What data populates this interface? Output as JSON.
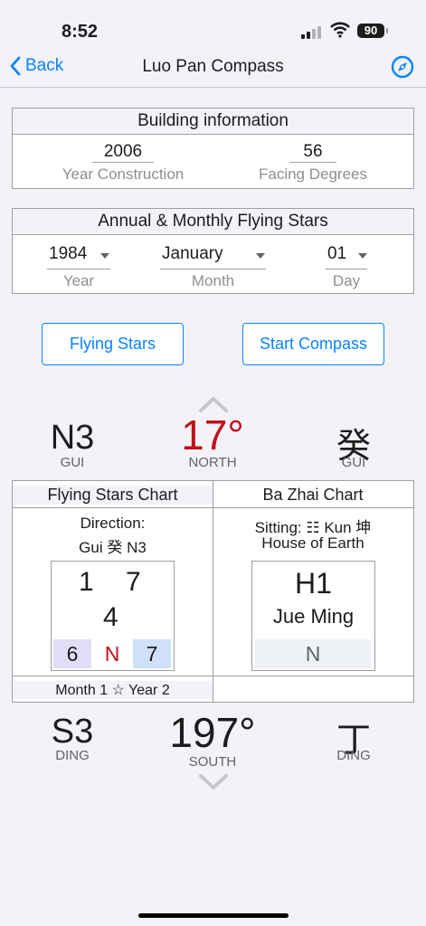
{
  "status": {
    "time": "8:52",
    "battery": "90"
  },
  "nav": {
    "back_label": "Back",
    "title": "Luo Pan Compass"
  },
  "building": {
    "title": "Building information",
    "year_value": "2006",
    "year_label": "Year Construction",
    "facing_value": "56",
    "facing_label": "Facing Degrees"
  },
  "stars": {
    "title": "Annual & Monthly Flying Stars",
    "year_value": "1984",
    "year_label": "Year",
    "month_value": "January",
    "month_label": "Month",
    "day_value": "01",
    "day_label": "Day"
  },
  "buttons": {
    "flying_stars": "Flying Stars",
    "start_compass": "Start Compass"
  },
  "north": {
    "left_code": "N3",
    "left_sub": "GUI",
    "degree": "17°",
    "degree_sub": "NORTH",
    "right_char": "癸",
    "right_sub": "GUI"
  },
  "flying_chart": {
    "header": "Flying Stars Chart",
    "direction_label": "Direction:",
    "direction_value": "Gui 癸 N3",
    "top_left": "1",
    "top_right": "7",
    "center": "4",
    "bottom_left": "6",
    "bottom_mid": "N",
    "bottom_right": "7",
    "footer": "Month 1 ☆ Year 2"
  },
  "bazhai": {
    "header": "Ba Zhai Chart",
    "sitting": "Sitting: ☷ Kun 坤",
    "house": "House of Earth",
    "code": "H1",
    "name": "Jue Ming",
    "dir": "N"
  },
  "south": {
    "left_code": "S3",
    "left_sub": "DING",
    "degree": "197°",
    "degree_sub": "SOUTH",
    "right_char": "丁",
    "right_sub": "DING"
  },
  "colors": {
    "accent": "#0a84ff",
    "north_degree": "#c0101a",
    "purple_cell": "#e3dcf7",
    "blue_cell": "#cfe0fb"
  }
}
